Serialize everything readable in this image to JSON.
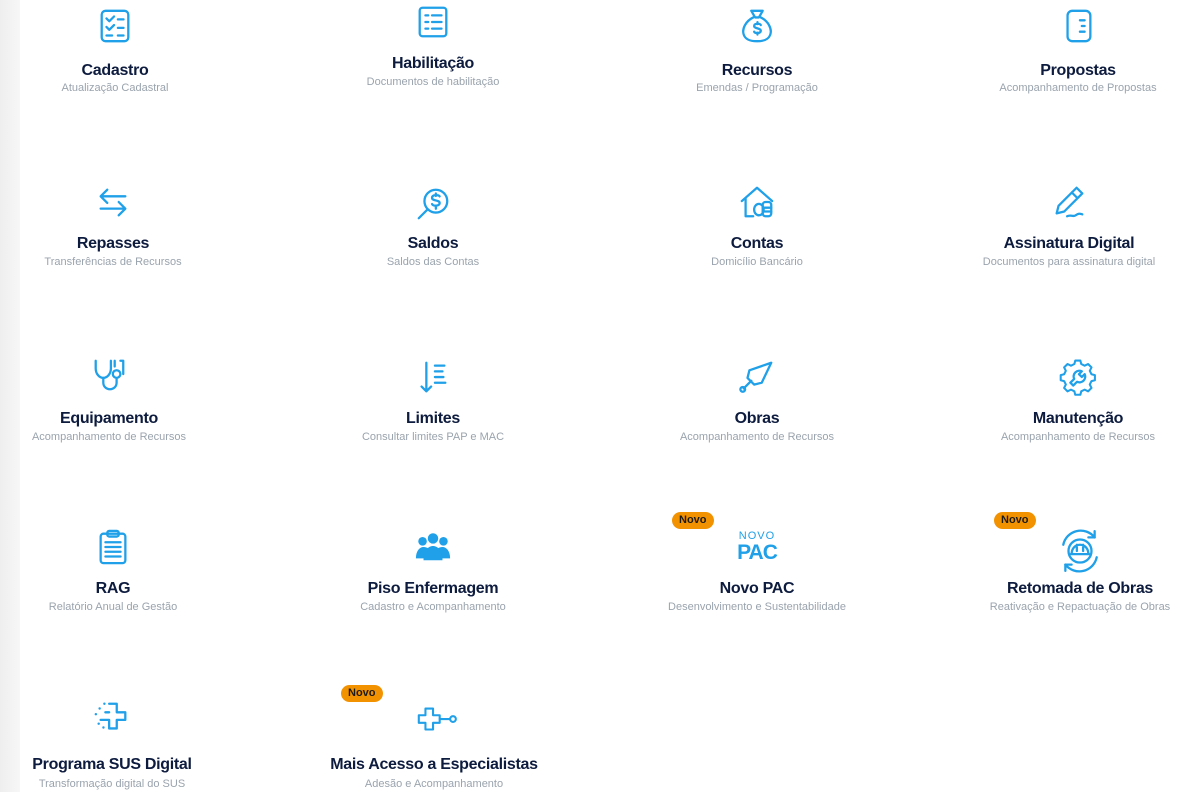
{
  "colors": {
    "accent": "#1fa0e8",
    "title": "#0d1b3e",
    "subtitle": "#9aa3ad",
    "badge": "#f39200"
  },
  "tiles": [
    {
      "title": "Cadastro",
      "subtitle": "Atualização Cadastral",
      "icon": "checklist-icon"
    },
    {
      "title": "Habilitação",
      "subtitle": "Documentos de habilitação",
      "icon": "list-document-icon"
    },
    {
      "title": "Recursos",
      "subtitle": "Emendas / Programação",
      "icon": "money-bag-icon"
    },
    {
      "title": "Propostas",
      "subtitle": "Acompanhamento de Propostas",
      "icon": "proposal-document-icon"
    },
    {
      "title": "Repasses",
      "subtitle": "Transferências de Recursos",
      "icon": "transfer-arrows-icon"
    },
    {
      "title": "Saldos",
      "subtitle": "Saldos das Contas",
      "icon": "balance-search-icon"
    },
    {
      "title": "Contas",
      "subtitle": "Domicílio Bancário",
      "icon": "house-coins-icon"
    },
    {
      "title": "Assinatura Digital",
      "subtitle": "Documentos para assinatura digital",
      "icon": "pen-signature-icon"
    },
    {
      "title": "Equipamento",
      "subtitle": "Acompanhamento de Recursos",
      "icon": "stethoscope-icon"
    },
    {
      "title": "Limites",
      "subtitle": "Consultar limites PAP e MAC",
      "icon": "sort-list-icon"
    },
    {
      "title": "Obras",
      "subtitle": "Acompanhamento de Recursos",
      "icon": "trowel-icon"
    },
    {
      "title": "Manutenção",
      "subtitle": "Acompanhamento de Recursos",
      "icon": "gear-wrench-icon"
    },
    {
      "title": "RAG",
      "subtitle": "Relatório Anual de Gestão",
      "icon": "clipboard-icon"
    },
    {
      "title": "Piso Enfermagem",
      "subtitle": "Cadastro e Acompanhamento",
      "icon": "people-group-icon"
    },
    {
      "title": "Novo PAC",
      "subtitle": "Desenvolvimento e Sustentabilidade",
      "icon": "novo-pac-logo",
      "badge": "Novo",
      "logo_top": "NOVO",
      "logo_main": "PAC"
    },
    {
      "title": "Retomada de Obras",
      "subtitle": "Reativação e Repactuação de Obras",
      "icon": "hardhat-cycle-icon",
      "badge": "Novo"
    },
    {
      "title": "Programa SUS Digital",
      "subtitle": "Transformação digital do SUS",
      "icon": "digital-health-cross-icon"
    },
    {
      "title": "Mais Acesso a Especialistas",
      "subtitle": "Adesão e Acompanhamento",
      "icon": "cross-connector-icon",
      "badge": "Novo"
    }
  ]
}
